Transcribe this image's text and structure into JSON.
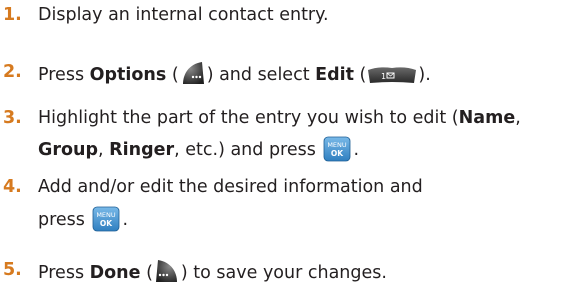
{
  "steps": [
    {
      "number": "1.",
      "text": "Display an internal contact entry."
    },
    {
      "number": "2.",
      "pre": "Press ",
      "options_label": "Options",
      "open_paren": " (",
      "options_icon": "right-softkey-icon",
      "mid": ") and select ",
      "edit_label": "Edit",
      "open_paren2": " (",
      "edit_icon": "key-1-icon",
      "end": ")."
    },
    {
      "number": "3.",
      "line1_pre": "Highlight the part of the entry you wish to edit (",
      "name_label": "Name",
      "line1_end": ",",
      "group_label": "Group",
      "comma": ", ",
      "ringer_label": "Ringer",
      "line2_mid": ", etc.) and press ",
      "ok_icon": "menu-ok-key-icon",
      "line2_end": "."
    },
    {
      "number": "4.",
      "line1": "Add and/or edit the desired information and",
      "line2_pre": "press ",
      "ok_icon": "menu-ok-key-icon",
      "line2_end": "."
    },
    {
      "number": "5.",
      "pre": "Press ",
      "done_label": "Done",
      "open_paren": " (",
      "done_icon": "left-softkey-icon",
      "end": ") to save your changes."
    }
  ],
  "icons": {
    "menu_ok_text_top": "MENU",
    "menu_ok_text_bottom": "OK",
    "key_1_text": "1"
  },
  "colors": {
    "step_number": "#d67a1f",
    "text": "#231f20",
    "softkey_dark": "#3a3a3a",
    "menu_ok_blue": "#3b8fd0"
  }
}
